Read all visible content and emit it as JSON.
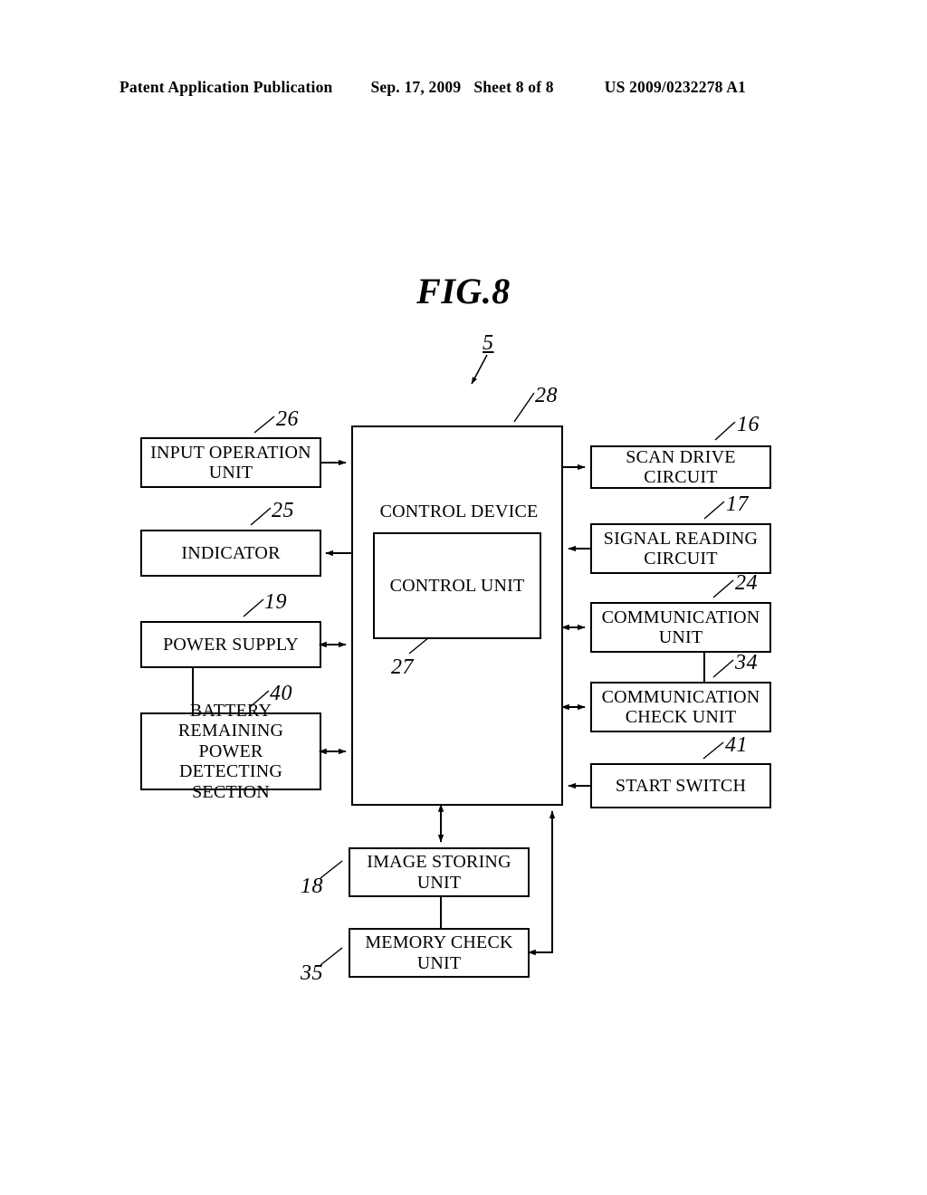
{
  "header": {
    "publication": "Patent Application Publication",
    "date": "Sep. 17, 2009",
    "sheet": "Sheet 8 of 8",
    "patent_number": "US 2009/0232278 A1"
  },
  "figure": {
    "title": "FIG.8",
    "system_ref": "5"
  },
  "diagram": {
    "type": "block-diagram",
    "blocks": [
      {
        "id": "input_operation_unit",
        "label": "INPUT OPERATION\nUNIT",
        "ref": "26"
      },
      {
        "id": "indicator",
        "label": "INDICATOR",
        "ref": "25"
      },
      {
        "id": "power_supply",
        "label": "POWER SUPPLY",
        "ref": "19"
      },
      {
        "id": "battery_detect",
        "label": "BATTERY\nREMAINING POWER\nDETECTING SECTION",
        "ref": "40"
      },
      {
        "id": "control_device",
        "label": "CONTROL DEVICE",
        "ref": "28"
      },
      {
        "id": "control_unit",
        "label": "CONTROL UNIT",
        "ref": "27"
      },
      {
        "id": "scan_drive_circuit",
        "label": "SCAN DRIVE CIRCUIT",
        "ref": "16"
      },
      {
        "id": "signal_reading_circuit",
        "label": "SIGNAL READING\nCIRCUIT",
        "ref": "17"
      },
      {
        "id": "communication_unit",
        "label": "COMMUNICATION\nUNIT",
        "ref": "24"
      },
      {
        "id": "communication_check_unit",
        "label": "COMMUNICATION\nCHECK UNIT",
        "ref": "34"
      },
      {
        "id": "start_switch",
        "label": "START SWITCH",
        "ref": "41"
      },
      {
        "id": "image_storing_unit",
        "label": "IMAGE STORING\nUNIT",
        "ref": "18"
      },
      {
        "id": "memory_check_unit",
        "label": "MEMORY CHECK\nUNIT",
        "ref": "35"
      }
    ],
    "connections": [
      {
        "from": "input_operation_unit",
        "to": "control_device",
        "arrow": "single"
      },
      {
        "from": "control_device",
        "to": "indicator",
        "arrow": "single"
      },
      {
        "from": "power_supply",
        "to": "control_device",
        "arrow": "double"
      },
      {
        "from": "battery_detect",
        "to": "control_device",
        "arrow": "double"
      },
      {
        "from": "power_supply",
        "to": "battery_detect",
        "arrow": "none"
      },
      {
        "from": "control_device",
        "to": "scan_drive_circuit",
        "arrow": "single"
      },
      {
        "from": "signal_reading_circuit",
        "to": "control_device",
        "arrow": "single"
      },
      {
        "from": "control_device",
        "to": "communication_unit",
        "arrow": "double"
      },
      {
        "from": "control_device",
        "to": "communication_check_unit",
        "arrow": "double"
      },
      {
        "from": "communication_unit",
        "to": "communication_check_unit",
        "arrow": "none"
      },
      {
        "from": "start_switch",
        "to": "control_device",
        "arrow": "single"
      },
      {
        "from": "control_device",
        "to": "image_storing_unit",
        "arrow": "double"
      },
      {
        "from": "image_storing_unit",
        "to": "memory_check_unit",
        "arrow": "none"
      },
      {
        "from": "memory_check_unit",
        "to": "control_device",
        "arrow": "single"
      }
    ]
  }
}
